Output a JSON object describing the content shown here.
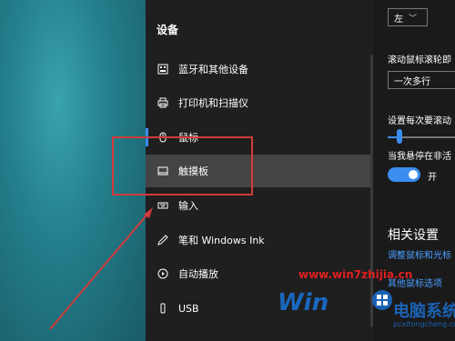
{
  "sidebar": {
    "section_title": "设备",
    "items": [
      {
        "label": "蓝牙和其他设备",
        "icon": "bluetooth-devices-icon"
      },
      {
        "label": "打印机和扫描仪",
        "icon": "printer-icon"
      },
      {
        "label": "鼠标",
        "icon": "mouse-icon"
      },
      {
        "label": "触摸板",
        "icon": "touchpad-icon"
      },
      {
        "label": "输入",
        "icon": "keyboard-icon"
      },
      {
        "label": "笔和 Windows Ink",
        "icon": "pen-icon"
      },
      {
        "label": "自动播放",
        "icon": "autoplay-icon"
      },
      {
        "label": "USB",
        "icon": "usb-icon"
      }
    ],
    "selected_index": 3
  },
  "right_panel": {
    "primary_button_value": "左",
    "wheel_label": "滚动鼠标滚轮即",
    "wheel_value": "一次多行",
    "lines_label": "设置每次要滚动",
    "slider_level": 0.15,
    "inactive_scroll_label": "当我悬停在非活",
    "toggle_state": "开",
    "toggle_on": true,
    "related_title": "相关设置",
    "link1": "调整鼠标和光标",
    "link2": "其他鼠标选项"
  },
  "watermark": {
    "url": "www.win7zhijia.cn",
    "brand": "Win",
    "brand_cn": "电脑系统城",
    "domain": "pcxitongcheng.com"
  },
  "colors": {
    "accent": "#3b8df0",
    "sidebar_bg": "#1f1f1f",
    "selected_bg": "#444444",
    "annotation_red": "#d23b3b"
  }
}
